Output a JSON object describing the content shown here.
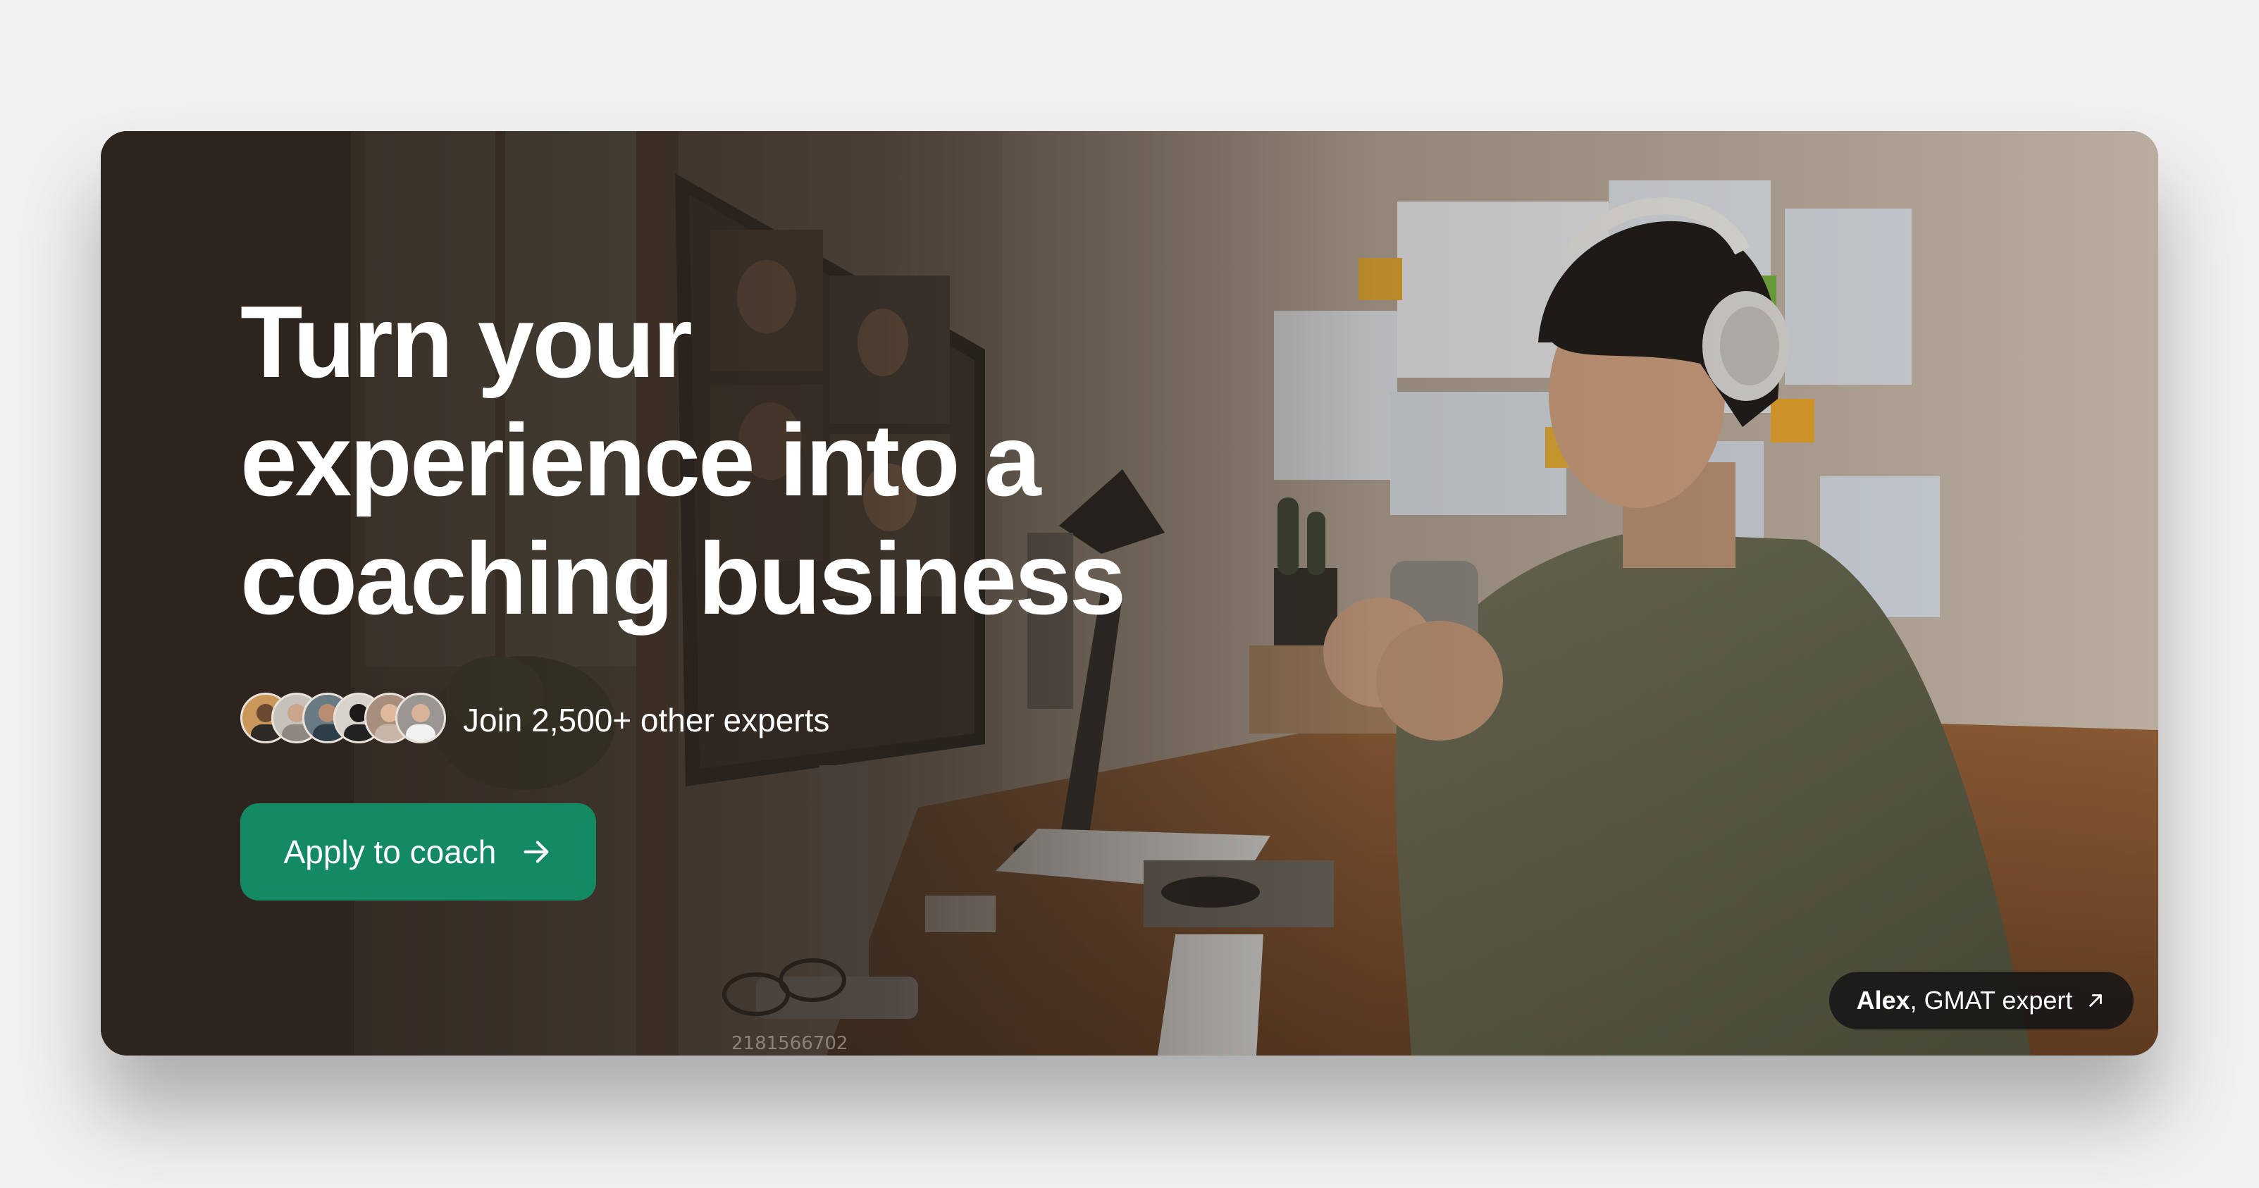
{
  "hero": {
    "headline_line1": "Turn your",
    "headline_line2": "experience into a",
    "headline_line3": "coaching business",
    "social_proof": "Join 2,500+ other experts",
    "cta_label": "Apply to coach",
    "cta_icon": "arrow-right-icon",
    "photo_credit_name": "Alex",
    "photo_credit_role": ", GMAT expert",
    "photo_credit_icon": "arrow-up-right-icon",
    "stock_photo_id": "2181566702"
  },
  "colors": {
    "page_background": "#f0f0f0",
    "cta_background": "#138a63",
    "credit_background": "#161616",
    "headline_text": "#ffffff"
  }
}
